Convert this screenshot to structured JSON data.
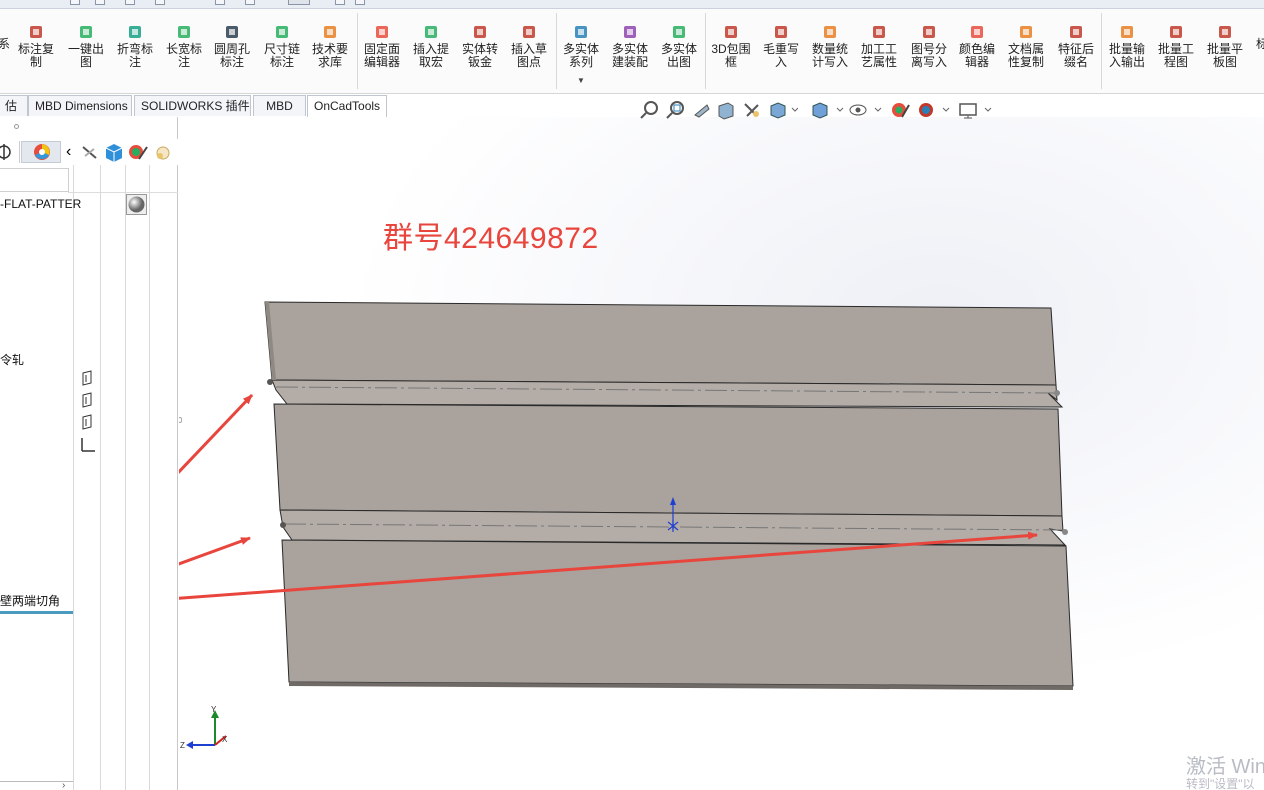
{
  "ribbon": {
    "items": [
      {
        "label": "标注复\n制",
        "icon": "copy-annotation-icon",
        "color": "#c0392b"
      },
      {
        "label": "一键出\n图",
        "icon": "one-click-drawing-icon",
        "color": "#27ae60"
      },
      {
        "label": "折弯标\n注",
        "icon": "bend-annotation-icon",
        "color": "#16a085"
      },
      {
        "label": "长宽标\n注",
        "icon": "length-width-annotation-icon",
        "color": "#27ae60"
      },
      {
        "label": "圆周孔\n标注",
        "icon": "circular-hole-annotation-icon",
        "color": "#2c3e50"
      },
      {
        "label": "尺寸链\n标注",
        "icon": "dimension-chain-icon",
        "color": "#27ae60"
      },
      {
        "label": "技术要\n求库",
        "icon": "tech-requirement-icon",
        "color": "#e67e22"
      },
      {
        "label": "固定面\n编辑器",
        "icon": "fixed-face-editor-icon",
        "color": "#e74c3c"
      },
      {
        "label": "插入提\n取宏",
        "icon": "insert-macro-icon",
        "color": "#27ae60"
      },
      {
        "label": "实体转\n钣金",
        "icon": "solid-to-sheetmetal-icon",
        "color": "#c0392b"
      },
      {
        "label": "插入草\n图点",
        "icon": "insert-sketch-point-icon",
        "color": "#c0392b"
      },
      {
        "label": "多实体\n系列",
        "icon": "multibody-series-icon",
        "color": "#2980b9"
      },
      {
        "label": "多实体\n建装配",
        "icon": "multibody-assembly-icon",
        "color": "#8e44ad"
      },
      {
        "label": "多实体\n出图",
        "icon": "multibody-drawing-icon",
        "color": "#27ae60"
      },
      {
        "label": "3D包围\n框",
        "icon": "bounding-box-icon",
        "color": "#c0392b"
      },
      {
        "label": "毛重写\n入",
        "icon": "gross-weight-icon",
        "color": "#c0392b"
      },
      {
        "label": "数量统\n计写入",
        "icon": "quantity-stats-icon",
        "color": "#e67e22"
      },
      {
        "label": "加工工\n艺属性",
        "icon": "process-property-icon",
        "color": "#c0392b"
      },
      {
        "label": "图号分\n离写入",
        "icon": "drawing-number-icon",
        "color": "#c0392b"
      },
      {
        "label": "颜色编\n辑器",
        "icon": "color-editor-icon",
        "color": "#e74c3c"
      },
      {
        "label": "文档属\n性复制",
        "icon": "doc-property-copy-icon",
        "color": "#e67e22"
      },
      {
        "label": "特征后\n缀名",
        "icon": "feature-suffix-icon",
        "color": "#c0392b"
      },
      {
        "label": "批量输\n入输出",
        "icon": "batch-io-icon",
        "color": "#e67e22"
      },
      {
        "label": "批量工\n程图",
        "icon": "batch-drawing-icon",
        "color": "#c0392b"
      },
      {
        "label": "批量平\n板图",
        "icon": "batch-flat-icon",
        "color": "#c0392b"
      }
    ],
    "edge_left_label": "系",
    "edge_right_label": "标"
  },
  "tabs": [
    {
      "label": "估",
      "active": false
    },
    {
      "label": "MBD Dimensions",
      "active": false
    },
    {
      "label": "SOLIDWORKS 插件",
      "active": false
    },
    {
      "label": "MBD",
      "active": false
    },
    {
      "label": "OnCadTools",
      "active": true
    }
  ],
  "feature_tree": {
    "item_flat_pattern": "-FLAT-PATTER",
    "item_cold_rolled": "令轧",
    "item_corner_cut": "壁两端切角"
  },
  "viewport": {
    "annotation": "群号424649872",
    "watermark_main": "激活 Win",
    "watermark_sub": "转到\"设置\"以"
  },
  "colors": {
    "part_face": "#a9a29d",
    "part_edge": "#2a2a2a",
    "arrow": "#e8453c",
    "annotation": "#e8453c"
  }
}
